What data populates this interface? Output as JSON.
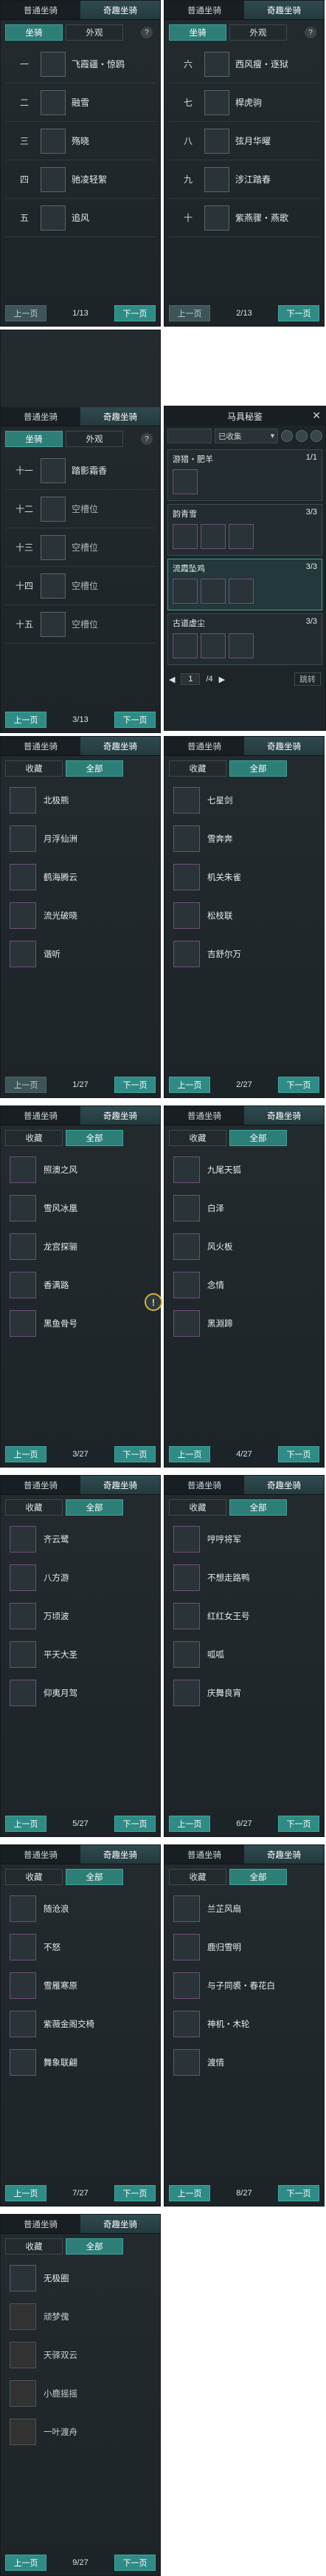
{
  "tabs": {
    "normal": "普通坐骑",
    "fun": "奇趣坐骑"
  },
  "subtabs": {
    "mount": "坐骑",
    "appearance": "外观",
    "collect": "收藏",
    "all": "全部",
    "help": "?"
  },
  "pager": {
    "prev": "上一页",
    "next": "下一页"
  },
  "panel1": {
    "count": "1/13",
    "rows": [
      {
        "num": "一",
        "name": "飞霞疆・惊鸥"
      },
      {
        "num": "二",
        "name": "融雪"
      },
      {
        "num": "三",
        "name": "殇晓"
      },
      {
        "num": "四",
        "name": "驰凌轻絮"
      },
      {
        "num": "五",
        "name": "追风"
      }
    ]
  },
  "panel2": {
    "count": "2/13",
    "rows": [
      {
        "num": "六",
        "name": "西风瘦・逐狱"
      },
      {
        "num": "七",
        "name": "桿虎驹"
      },
      {
        "num": "八",
        "name": "弦月华曜"
      },
      {
        "num": "九",
        "name": "涉江踏春"
      },
      {
        "num": "十",
        "name": "紫燕骤・燕歌"
      }
    ]
  },
  "panel3": {
    "count": "3/13",
    "rows": [
      {
        "num": "十一",
        "name": "踏影霜香"
      },
      {
        "num": "十二",
        "name": "空槽位"
      },
      {
        "num": "十三",
        "name": "空槽位"
      },
      {
        "num": "十四",
        "name": "空槽位"
      },
      {
        "num": "十五",
        "name": "空槽位"
      }
    ]
  },
  "secret": {
    "title": "马具秘鉴",
    "filter": "已收集",
    "close": "✕",
    "sets": [
      {
        "name": "游猎・肥羊",
        "count": "1/1"
      },
      {
        "name": "韵青雪",
        "count": "3/3"
      },
      {
        "name": "流霞坠鸡",
        "count": "3/3"
      },
      {
        "name": "古道虚尘",
        "count": "3/3"
      }
    ],
    "page": "1",
    "pages": "/4",
    "jump": "跳转"
  },
  "collections": [
    {
      "count": "1/27",
      "items": [
        "北极熊",
        "月浮仙洲",
        "鹤海腾云",
        "流光破晓",
        "谐听"
      ]
    },
    {
      "count": "2/27",
      "items": [
        "七星剑",
        "雪奔奔",
        "机关朱雀",
        "松枝联",
        "吉舒尔万"
      ]
    },
    {
      "count": "3/27",
      "items": [
        "照澳之风",
        "雪风冰凰",
        "龙宫探骊",
        "香满路",
        "黑鱼骨号"
      ]
    },
    {
      "count": "4/27",
      "items": [
        "九尾天狐",
        "白泽",
        "风火板",
        "念情",
        "黑淵蹄"
      ]
    },
    {
      "count": "5/27",
      "items": [
        "齐云鹭",
        "八方游",
        "万顷波",
        "平天大圣",
        "仰夷月驾"
      ]
    },
    {
      "count": "6/27",
      "items": [
        "哼哼将军",
        "不想走路鸭",
        "红红女王号",
        "呱呱",
        "庆舞良宵"
      ]
    },
    {
      "count": "7/27",
      "items": [
        "随沧浪",
        "不怒",
        "雪雁寒原",
        "紫薇金阁交椅",
        "舞象联翩"
      ]
    },
    {
      "count": "8/27",
      "items": [
        "兰芷风扇",
        "鹿归雪明",
        "与子同裘・春花白",
        "神机・木轮",
        "渡情"
      ]
    },
    {
      "count": "9/27",
      "items": [
        "无极圈",
        "顽梦傀",
        "天驿双云",
        "小鹿摇摇",
        "一叶渡舟"
      ]
    }
  ]
}
